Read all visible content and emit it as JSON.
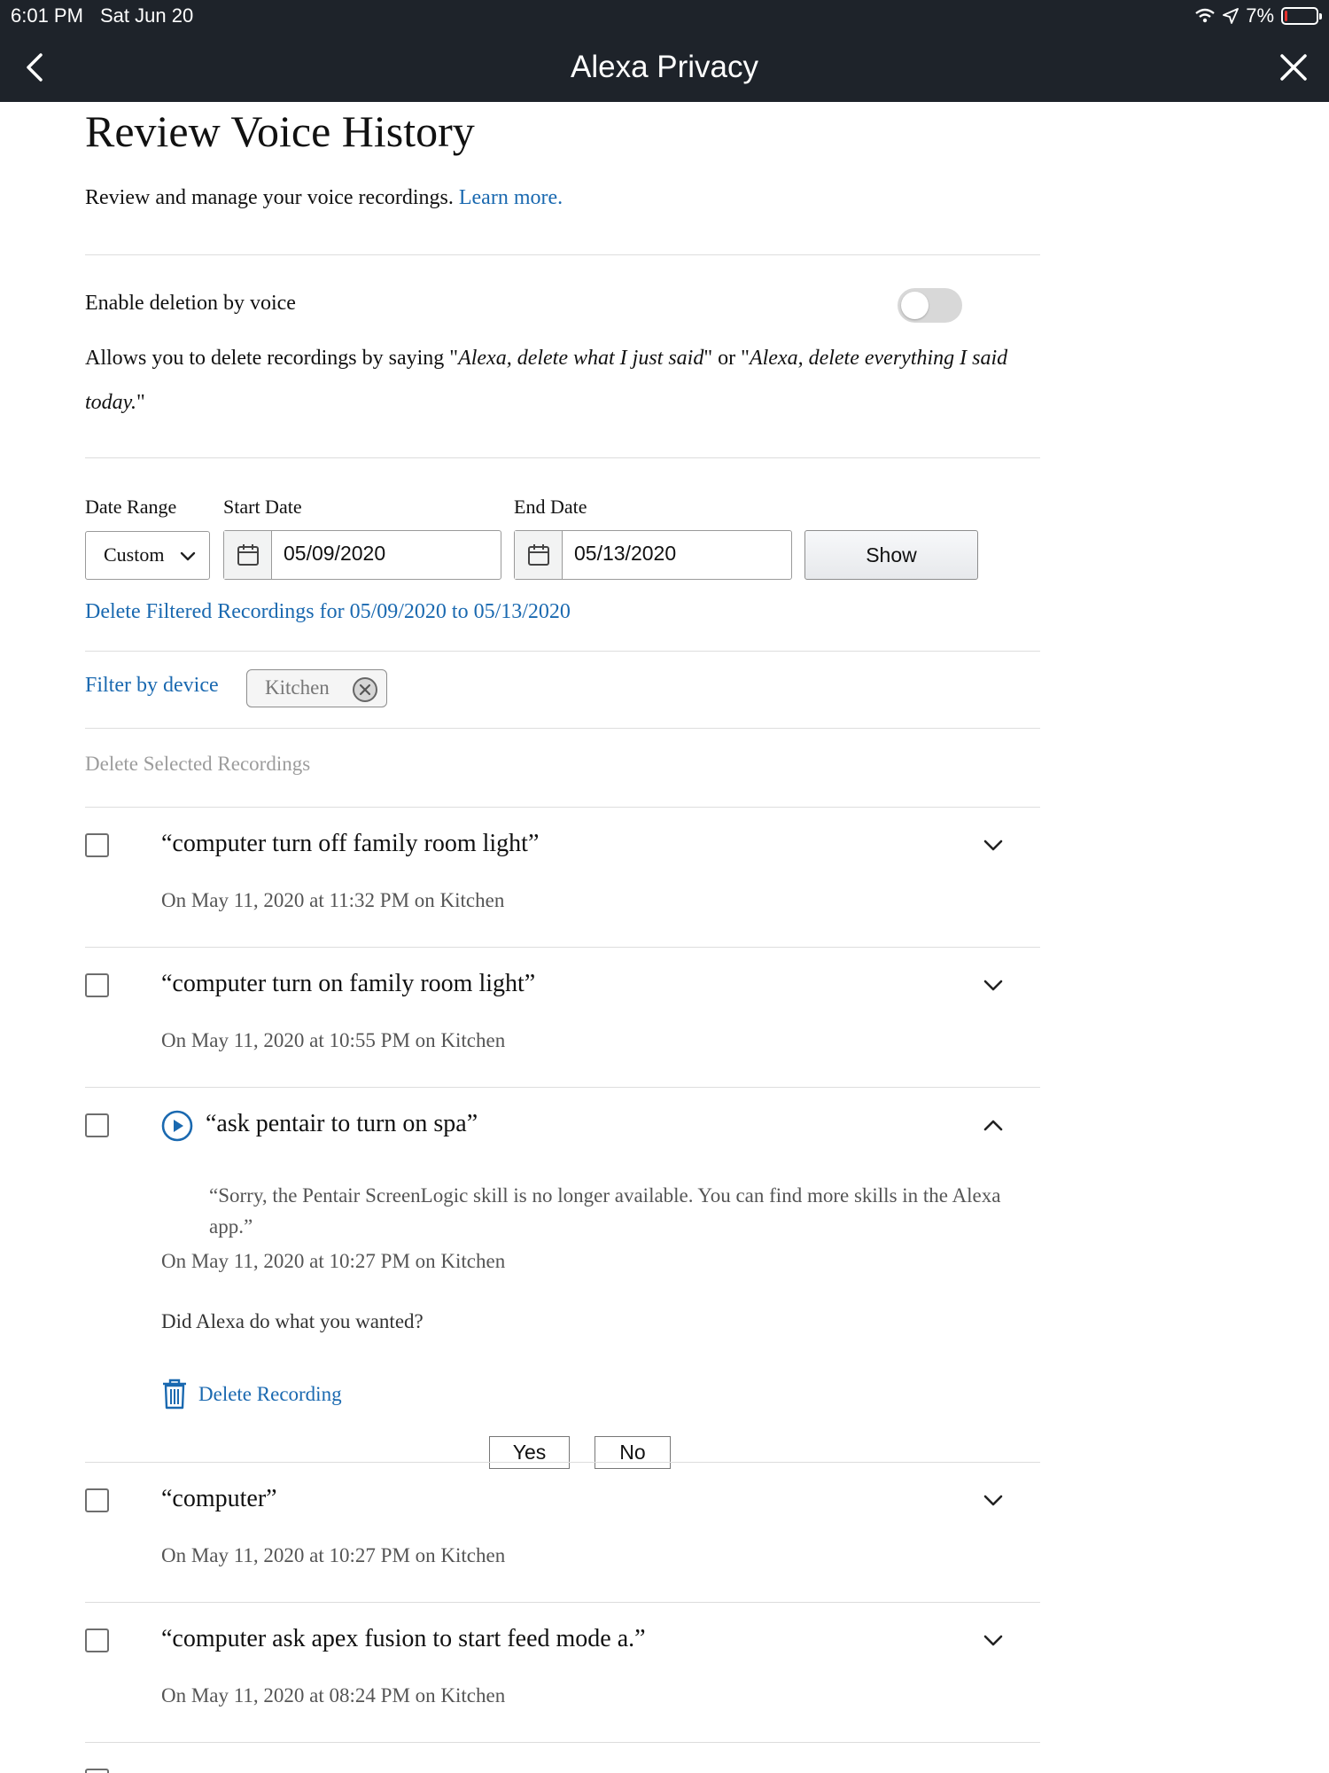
{
  "status_bar": {
    "time": "6:01 PM",
    "date": "Sat Jun 20",
    "battery": "7%",
    "battery_level": 0.07
  },
  "nav": {
    "title": "Alexa Privacy"
  },
  "page": {
    "title": "Review Voice History",
    "intro_text": "Review and manage your voice recordings.",
    "intro_link": "Learn more."
  },
  "toggle": {
    "label": "Enable deletion by voice",
    "enabled": false,
    "desc_prefix": "Allows you to delete recordings by saying \"",
    "desc_phrase1": "Alexa, delete what I just said",
    "desc_middle": "\" or \"",
    "desc_phrase2": "Alexa, delete everything I said today.",
    "desc_suffix": "\""
  },
  "filters": {
    "date_range_label": "Date Range",
    "start_date_label": "Start Date",
    "end_date_label": "End Date",
    "date_range_value": "Custom",
    "start_date": "05/09/2020",
    "end_date": "05/13/2020",
    "show_label": "Show",
    "delete_filtered": "Delete Filtered Recordings for 05/09/2020 to 05/13/2020",
    "filter_by_device": "Filter by device",
    "device_chip": "Kitchen",
    "delete_selected": "Delete Selected Recordings"
  },
  "recordings": [
    {
      "utterance": "“computer turn off family room light”",
      "meta": "On May 11, 2020 at 11:32 PM on Kitchen",
      "expanded": false
    },
    {
      "utterance": "“computer turn on family room light”",
      "meta": "On May 11, 2020 at 10:55 PM on Kitchen",
      "expanded": false
    },
    {
      "utterance": "“ask pentair to turn on spa”",
      "response": "“Sorry, the Pentair ScreenLogic skill is no longer available. You can find more skills in the Alexa app.”",
      "meta": "On May 11, 2020 at 10:27 PM on Kitchen",
      "expanded": true,
      "feedback_question": "Did Alexa do what you wanted?",
      "yes_label": "Yes",
      "no_label": "No",
      "delete_label": "Delete Recording"
    },
    {
      "utterance": "“computer”",
      "meta": "On May 11, 2020 at 10:27 PM on Kitchen",
      "expanded": false
    },
    {
      "utterance": "“computer ask apex fusion to start feed mode a.”",
      "meta": "On May 11, 2020 at 08:24 PM on Kitchen",
      "expanded": false
    }
  ],
  "colors": {
    "header_bg": "#1e232a",
    "link": "#1a69b0",
    "divider": "#dddddd"
  }
}
